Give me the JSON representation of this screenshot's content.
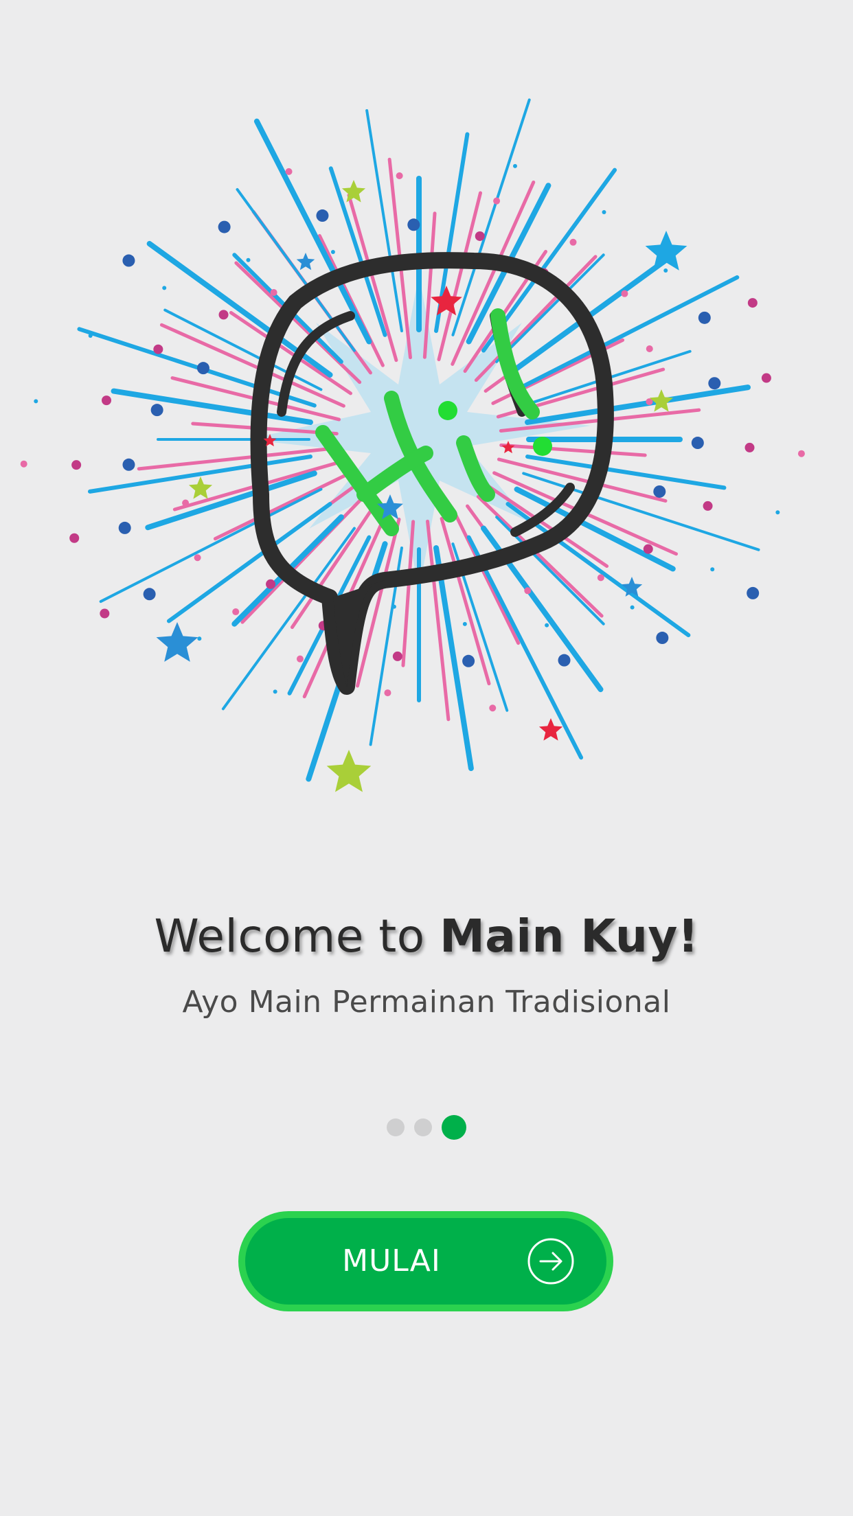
{
  "onboarding": {
    "title_prefix": "Welcome to ",
    "title_brand": "Main Kuy!",
    "subtitle": "Ayo Main Permainan Tradisional",
    "pager": {
      "total": 3,
      "current": 3,
      "inactive_color": "#cfcfd0",
      "active_color": "#00b04a"
    },
    "start_button": {
      "label": "MULAI",
      "icon": "arrow-right-circle-icon"
    },
    "hero_icons": [
      "speech-bubble-icon",
      "firework-burst",
      "star-icon"
    ]
  },
  "colors": {
    "background": "#ececed",
    "brand_green": "#00b04a",
    "button_border": "#2bd24f",
    "burst_blue": "#1ea7e3",
    "burst_pink": "#e86aa6",
    "star_yellow": "#a9cf38",
    "star_red": "#e8253f",
    "star_blue": "#2a8fd6",
    "bubble_outline": "#2d2d2d",
    "doodle_green": "#33cc44"
  }
}
